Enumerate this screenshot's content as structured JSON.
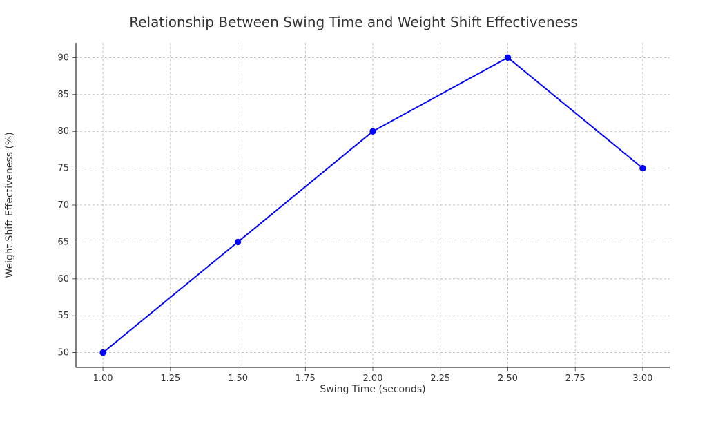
{
  "chart_data": {
    "type": "line",
    "title": "Relationship Between Swing Time and Weight Shift Effectiveness",
    "xlabel": "Swing Time (seconds)",
    "ylabel": "Weight Shift Effectiveness (%)",
    "x": [
      1.0,
      1.5,
      2.0,
      2.5,
      3.0
    ],
    "values": [
      50,
      65,
      80,
      90,
      75
    ],
    "x_ticks": [
      1.0,
      1.25,
      1.5,
      1.75,
      2.0,
      2.25,
      2.5,
      2.75,
      3.0
    ],
    "x_tick_labels": [
      "1.00",
      "1.25",
      "1.50",
      "1.75",
      "2.00",
      "2.25",
      "2.50",
      "2.75",
      "3.00"
    ],
    "y_ticks": [
      50,
      55,
      60,
      65,
      70,
      75,
      80,
      85,
      90
    ],
    "y_tick_labels": [
      "50",
      "55",
      "60",
      "65",
      "70",
      "75",
      "80",
      "85",
      "90"
    ],
    "xlim": [
      0.9,
      3.1
    ],
    "ylim": [
      48,
      92
    ],
    "grid": true,
    "line_color": "#0000ff",
    "marker": "o"
  }
}
